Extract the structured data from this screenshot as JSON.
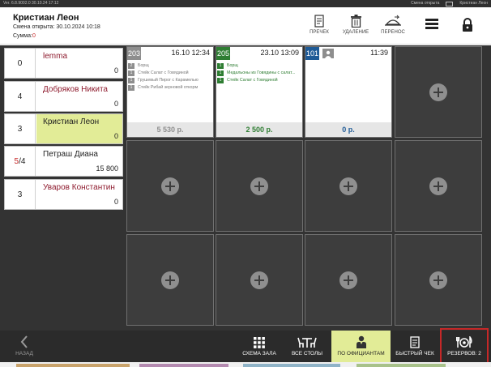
{
  "sysbar": {
    "left": "Ver. 6.8.9002.0   30.10.24   17:12",
    "status": "Смена открыта",
    "user": "Кристиан Леон"
  },
  "header": {
    "name": "Кристиан Леон",
    "shift_label": "Смена открыта:",
    "shift_time": "30.10.2024 10:18",
    "sum_label": "Сумма:",
    "sum_value": "0",
    "tools": {
      "precheck": "ПРЕЧЕК",
      "delete": "УДАЛЕНИЕ",
      "transfer": "ПЕРЕНОС"
    }
  },
  "waiters": [
    {
      "count": "0",
      "count_red": "",
      "name": "lemma",
      "amount": "0"
    },
    {
      "count": "4",
      "count_red": "",
      "name": "Добряков Никита",
      "amount": "0"
    },
    {
      "count": "3",
      "count_red": "",
      "name": "Кристиан Леон",
      "amount": "0"
    },
    {
      "count": "/4",
      "count_red": "5",
      "name": "Петраш Диана",
      "amount": "15 800"
    },
    {
      "count": "3",
      "count_red": "",
      "name": "Уваров Константин",
      "amount": "0"
    }
  ],
  "orders": [
    {
      "table": "203",
      "date": "16.10 12:34",
      "items": [
        {
          "q": "2",
          "name": "Борщ"
        },
        {
          "q": "1",
          "name": "Стейк Салат с Говядиной"
        },
        {
          "q": "1",
          "name": "Грушевый Пирог с Карамелью"
        },
        {
          "q": "1",
          "name": "Стейк Рибай зерновой откорм"
        }
      ],
      "total": "5 530 р."
    },
    {
      "table": "205",
      "date": "23.10 13:09",
      "items": [
        {
          "q": "1",
          "name": "Борщ"
        },
        {
          "q": "1",
          "name": "Медальоны из Говядины с салат..."
        },
        {
          "q": "1",
          "name": "Стейк Салат с Говядиной"
        }
      ],
      "total": "2 500 р."
    },
    {
      "table": "101",
      "date": "11:39",
      "items": [],
      "total": "0 р."
    }
  ],
  "toolbar": {
    "back": "НАЗАД",
    "hall": "СХЕМА ЗАЛА",
    "all_tables": "ВСЕ СТОЛЫ",
    "by_waiters": "ПО ОФИЦИАНТАМ",
    "quick_check": "БЫСТРЫЙ ЧЕК",
    "reservations": "РЕЗЕРВОВ: 2"
  },
  "colors": {
    "accent_selected": "#e2ec97",
    "table_gray": "#8e8e8e",
    "table_green": "#2e7d32",
    "table_blue": "#1e5a96",
    "highlight_red": "#c62828"
  }
}
